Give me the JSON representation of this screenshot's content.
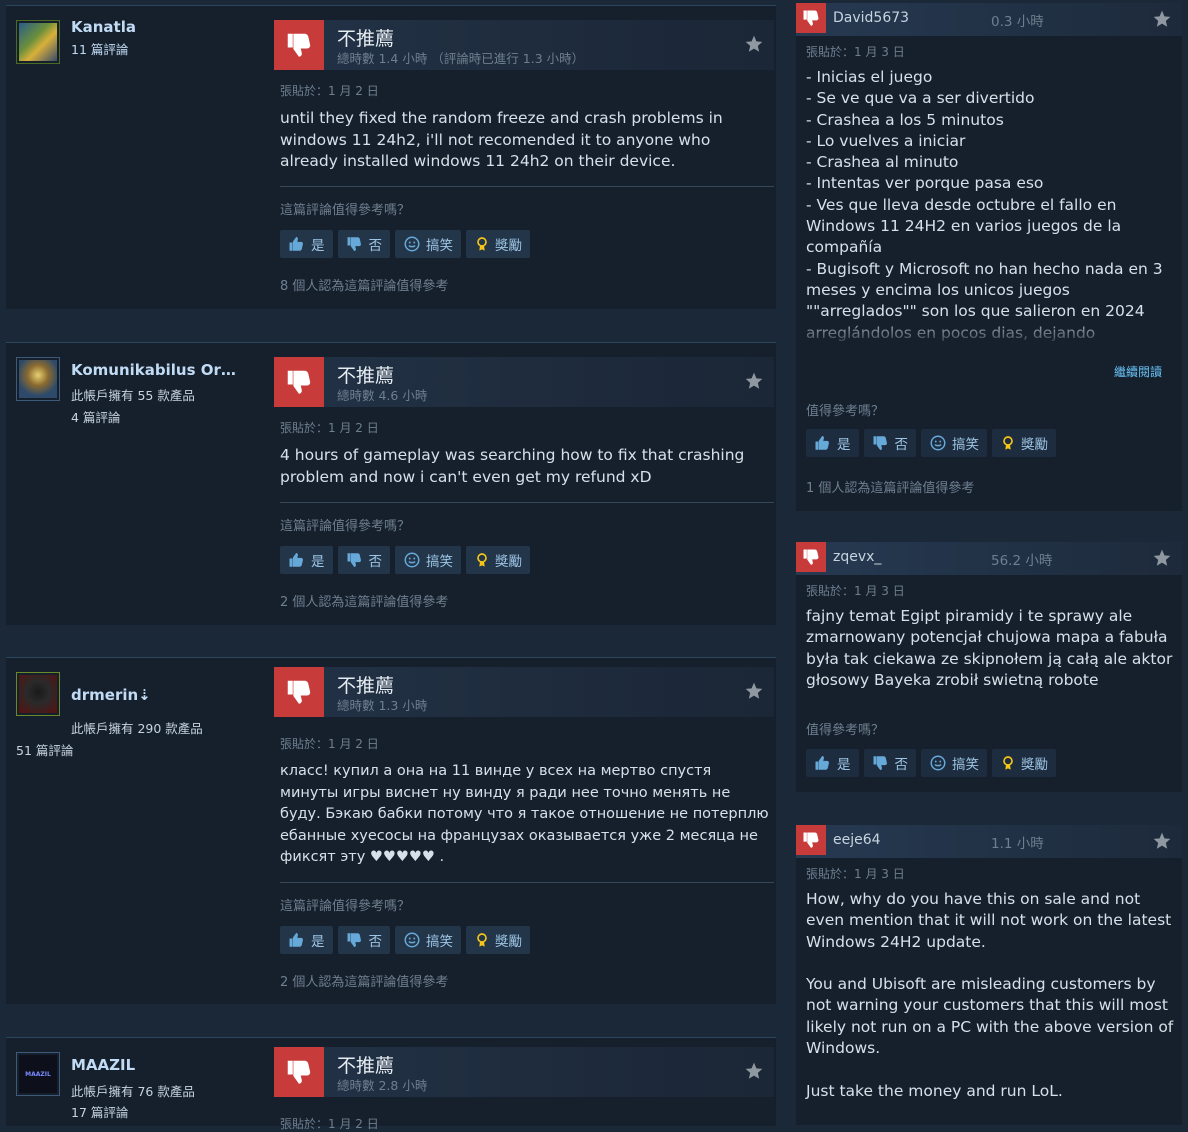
{
  "labels": {
    "not_recommended": "不推薦",
    "helpful_q": "這篇評論值得參考嗎？",
    "helpful_q_short": "值得參考嗎？",
    "yes": "是",
    "no": "否",
    "funny": "搞笑",
    "award": "獎勵",
    "read_more": "繼續閱讀"
  },
  "colors": {
    "background": "#1b2838",
    "card": "#16202d",
    "thumb_down": "#c83b3b",
    "link": "#66c0f4",
    "button": "#233549"
  },
  "icons": [
    "thumbs-down-icon",
    "star-icon",
    "thumbs-up-icon",
    "smiley-icon",
    "award-icon"
  ],
  "left_reviews": [
    {
      "persona": "Kanatla",
      "reviews_count": "11 篇評論",
      "hours": "總時數 1.4 小時 （評論時已進行 1.3 小時）",
      "posted": "張貼於：1 月 2 日",
      "content": "until they fixed the random freeze and crash problems in windows 11 24h2, i'll not recomended it to anyone who already installed windows 11 24h2 on their device.",
      "helpful": "8 個人認為這篇評論值得參考"
    },
    {
      "persona": "Komunikabilus Oran...",
      "products": "此帳戶擁有 55 款產品",
      "reviews_count": "4 篇評論",
      "hours": "總時數 4.6 小時",
      "posted": "張貼於：1 月 2 日",
      "content": "4 hours of gameplay was searching how to fix that crashing problem and now i can't even get my refund xD",
      "helpful": "2 個人認為這篇評論值得參考"
    },
    {
      "persona": "drmerin⇣",
      "products": "此帳戶擁有 290 款產品",
      "reviews_count": "51 篇評論",
      "hours": "總時數 1.3 小時",
      "posted": "張貼於：1 月 2 日",
      "content": "класс! купил а она на 11 винде у всех на мертво спустя минуты игры виснет ну винду я ради нее точно менять не буду. Бэкаю бабки потому что я такое отношение не потерплю ебанные хуесосы на французах оказывается уже 2 месяца не фиксят эту ♥♥♥♥♥ .",
      "helpful": "2 個人認為這篇評論值得參考"
    },
    {
      "persona": "MAAZIL",
      "avatar_text": "MAAZIL",
      "products": "此帳戶擁有 76 款產品",
      "reviews_count": "17 篇評論",
      "hours": "總時數 2.8 小時",
      "posted": "張貼於：1 月 2 日"
    }
  ],
  "right_reviews": [
    {
      "name": "David5673",
      "hours": "0.3 小時",
      "posted": "張貼於：1 月 3 日",
      "content": "- Inicias el juego\n- Se ve que va a ser divertido\n- Crashea a los 5 minutos\n- Lo vuelves a iniciar\n- Crashea al minuto\n- Intentas ver porque pasa eso\n- Ves que lleva desde octubre el fallo en Windows 11 24H2 en varios juegos de la compañía\n- Bugisoft y Microsoft no han hecho nada en 3 meses y encima los unicos juegos \"\"arreglados\"\" son los que salieron en 2024 arreglándolos en pocos dias, dejando",
      "helpful": "1 個人認為這篇評論值得參考"
    },
    {
      "name": "zqevx_",
      "hours": "56.2 小時",
      "posted": "張貼於：1 月 3 日",
      "content": "fajny temat Egipt piramidy i te sprawy ale zmarnowany potencjał chujowa mapa a fabuła była tak ciekawa ze skipnołem ją całą ale aktor głosowy Bayeka zrobił swietną robote"
    },
    {
      "name": "eeje64",
      "hours": "1.1 小時",
      "posted": "張貼於：1 月 3 日",
      "content": "How, why do you have this on sale and not even mention that it will not work on the latest Windows 24H2 update.\n\nYou and Ubisoft are misleading customers by not warning your customers that this will most likely not run on a PC with the above version of Windows.\n\nJust take the money and run LoL."
    }
  ]
}
